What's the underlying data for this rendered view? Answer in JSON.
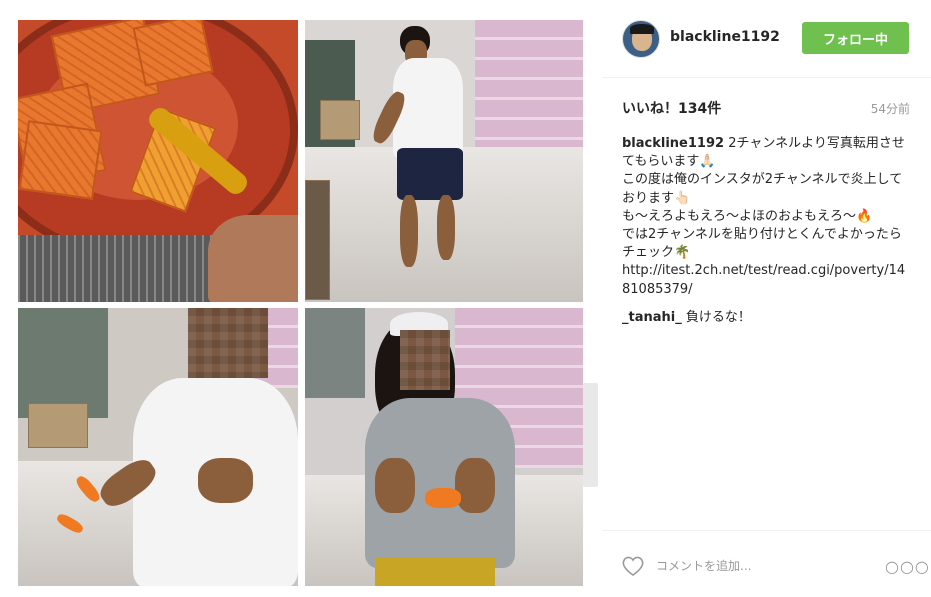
{
  "header": {
    "username": "blackline1192",
    "follow_label": "フォロー中"
  },
  "stats": {
    "likes": "いいね！134件",
    "time": "54分前"
  },
  "comments": [
    {
      "user": "blackline1192",
      "text": " 2チャンネルより写真転用させてもらいます",
      "text_emoji": "🙏🏻",
      "line2": "この度は俺のインスタが2チャンネルで炎上しております",
      "line2_emoji": "👆🏻",
      "line3": "も〜えろよもえろ〜よほのおよもえろ〜",
      "line3_emoji": "🔥",
      "line4": "では2チャンネルを貼り付けとくんでよかったらチェック",
      "line4_emoji": "🌴",
      "link": "http://itest.2ch.net/test/read.cgi/poverty/1481085379/"
    },
    {
      "user": "_tanahi_",
      "text": " 負けるな！"
    }
  ],
  "footer": {
    "comment_placeholder": "コメントを追加...",
    "more_label": "○○○"
  },
  "icons": {
    "heart": "heart-icon",
    "more": "more-options-icon"
  },
  "colors": {
    "follow_button": "#70c050",
    "text": "#262626",
    "muted": "#999999"
  }
}
